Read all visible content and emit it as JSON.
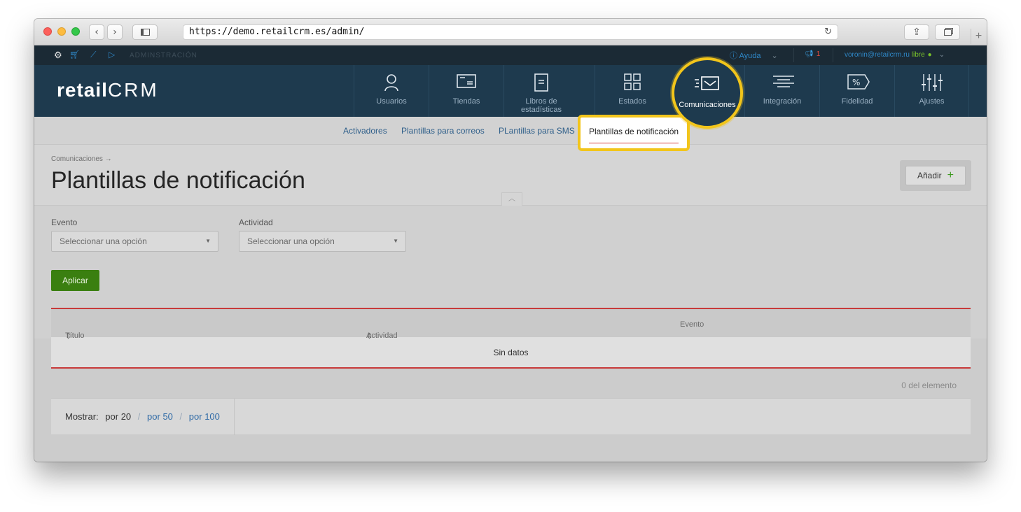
{
  "browser": {
    "url": "https://demo.retailcrm.es/admin/"
  },
  "adminbar": {
    "section": "ADMINSTRACIÓN",
    "help": "Ayuda",
    "notifications": "1",
    "user_email": "voronin@retailcrm.ru",
    "user_status": "libre"
  },
  "logo": {
    "text_a": "retail",
    "text_b": "CRM"
  },
  "nav": {
    "items": [
      {
        "label": "Usuarios",
        "icon": "user-icon"
      },
      {
        "label": "Tiendas",
        "icon": "store-icon"
      },
      {
        "label": "Libros de estadísticas",
        "icon": "book-icon"
      },
      {
        "label": "Estados",
        "icon": "grid-icon"
      },
      {
        "label": "Comunicaciones",
        "icon": "message-icon",
        "active": true
      },
      {
        "label": "Integración",
        "icon": "integration-icon"
      },
      {
        "label": "Fidelidad",
        "icon": "percent-tag-icon"
      },
      {
        "label": "Ajustes",
        "icon": "sliders-icon"
      }
    ]
  },
  "subnav": {
    "items": [
      "Activadores",
      "Plantillas para correos",
      "PLantillas para SMS",
      "Plantillas de notificación"
    ]
  },
  "page": {
    "breadcrumb": "Comunicaciones →",
    "title": "Plantillas de notificación",
    "add_label": "Añadir",
    "add_icon": "plus-icon"
  },
  "filters": {
    "event_label": "Evento",
    "event_placeholder": "Seleccionar una opción",
    "activity_label": "Actividad",
    "activity_placeholder": "Seleccionar una opción",
    "apply_label": "Aplicar"
  },
  "table": {
    "columns": [
      "Título",
      "Actividad",
      "Evento"
    ],
    "empty": "Sin datos",
    "count": "0 del elemento"
  },
  "pager": {
    "label": "Mostrar:",
    "options": [
      "por 20",
      "por 50",
      "por 100"
    ]
  },
  "colors": {
    "highlight": "#f2c51b",
    "nav_bg": "#1e3a4e",
    "apply_green": "#3a7f10",
    "table_accent": "#c83a3a"
  }
}
